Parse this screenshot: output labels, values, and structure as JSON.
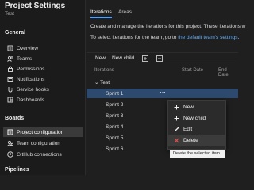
{
  "sidebar": {
    "title": "Project Settings",
    "subtitle": "Test",
    "sections": {
      "general": "General",
      "boards": "Boards",
      "pipelines": "Pipelines"
    },
    "general_items": [
      {
        "label": "Overview",
        "icon": "overview-icon"
      },
      {
        "label": "Teams",
        "icon": "teams-icon"
      },
      {
        "label": "Permissions",
        "icon": "lock-icon"
      },
      {
        "label": "Notifications",
        "icon": "notifications-icon"
      },
      {
        "label": "Service hooks",
        "icon": "service-hooks-icon"
      },
      {
        "label": "Dashboards",
        "icon": "dashboards-icon"
      }
    ],
    "boards_items": [
      {
        "label": "Project configuration",
        "icon": "project-config-icon",
        "active": true
      },
      {
        "label": "Team configuration",
        "icon": "team-config-icon"
      },
      {
        "label": "GitHub connections",
        "icon": "github-icon"
      }
    ]
  },
  "main": {
    "tabs": [
      {
        "label": "Iterations",
        "active": true
      },
      {
        "label": "Areas",
        "active": false
      }
    ],
    "description": "Create and manage the iterations for this project. These iterations w",
    "team_note_prefix": "To select iterations for the team, go to ",
    "team_note_link": "the default team's settings",
    "team_note_suffix": ".",
    "toolbar": {
      "new": "New",
      "new_child": "New child"
    },
    "columns": {
      "iterations": "Iterations",
      "start_date": "Start Date",
      "end_date": "End Date"
    },
    "root": "Test",
    "sprints": [
      "Sprint 1",
      "Sprint 2",
      "Sprint 3",
      "Sprint 4",
      "Sprint 5",
      "Sprint 6"
    ],
    "selected_sprint": "Sprint 1",
    "more_glyph": "⋯"
  },
  "context_menu": {
    "items": [
      {
        "label": "New",
        "icon": "plus-icon"
      },
      {
        "label": "New child",
        "icon": "plus-icon"
      },
      {
        "label": "Edit",
        "icon": "pencil-icon"
      },
      {
        "label": "Delete",
        "icon": "close-icon"
      }
    ],
    "tooltip": "Delete the selected item"
  },
  "colors": {
    "accent": "#4fa3ff",
    "link": "#69aef7",
    "selected_row": "#2d4a6e",
    "delete_icon": "#e05050"
  }
}
